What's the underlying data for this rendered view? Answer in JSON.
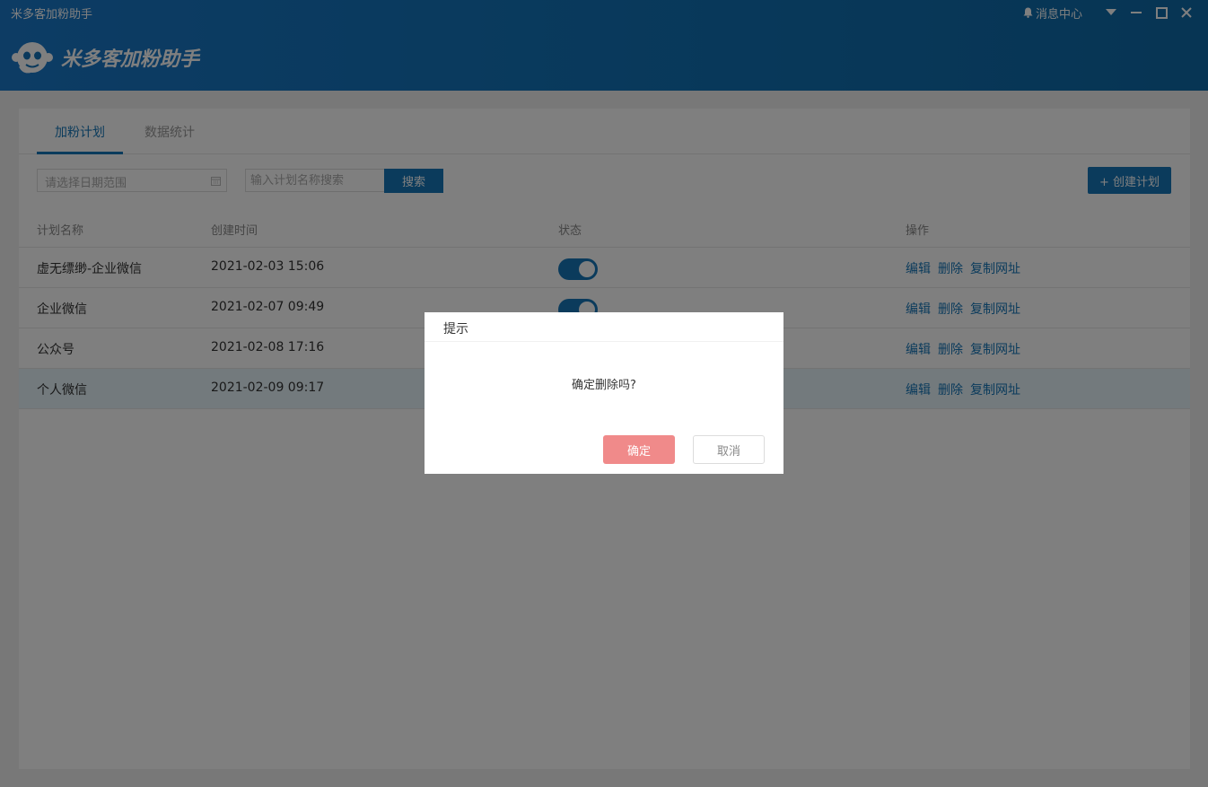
{
  "window": {
    "title": "米多客加粉助手",
    "message_center": "消息中心"
  },
  "brand": {
    "logo_text": "米多客加粉助手"
  },
  "tabs": [
    {
      "label": "加粉计划"
    },
    {
      "label": "数据统计"
    }
  ],
  "toolbar": {
    "date_placeholder": "请选择日期范围",
    "search_placeholder": "输入计划名称搜索",
    "search_label": "搜索",
    "create_label": "+ 创建计划"
  },
  "table": {
    "headers": [
      "计划名称",
      "创建时间",
      "状态",
      "操作"
    ],
    "rows": [
      {
        "name": "虚无缥缈-企业微信",
        "created": "2021-02-03 15:06",
        "enabled": true
      },
      {
        "name": "企业微信",
        "created": "2021-02-07 09:49",
        "enabled": true
      },
      {
        "name": "公众号",
        "created": "2021-02-08 17:16",
        "enabled": true
      },
      {
        "name": "个人微信",
        "created": "2021-02-09 09:17",
        "enabled": true
      }
    ],
    "actions": {
      "edit": "编辑",
      "delete": "删除",
      "copy": "复制网址"
    }
  },
  "dialog": {
    "title": "提示",
    "message": "确定删除吗?",
    "ok_label": "确定",
    "cancel_label": "取消"
  },
  "colors": {
    "primary": "#1677b9",
    "danger_soft": "#f08a8a"
  }
}
